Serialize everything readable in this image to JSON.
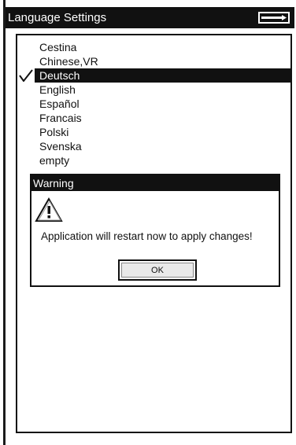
{
  "window": {
    "title": "Language Settings",
    "battery_icon": "battery-arrow-icon"
  },
  "languages": {
    "items": [
      "Cestina",
      "Chinese,VR",
      "Deutsch",
      "English",
      "Español",
      "Francais",
      "Polski",
      "Svenska",
      "empty"
    ],
    "selected": "Deutsch"
  },
  "dialog": {
    "title": "Warning",
    "icon": "warning-icon",
    "message": "Application will restart now to apply changes!",
    "ok_label": "OK"
  },
  "colors": {
    "bar": "#111111",
    "background": "#ffffff",
    "button_face": "#e9e9e9"
  }
}
